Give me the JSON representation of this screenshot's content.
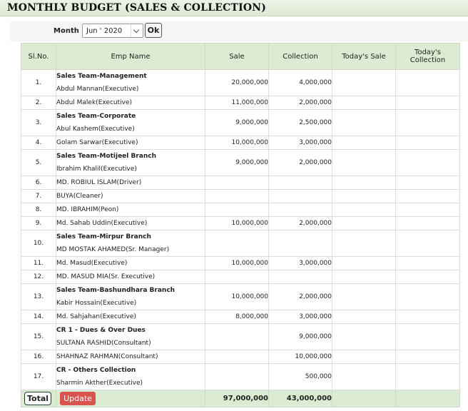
{
  "header": {
    "title": "MONTHLY BUDGET (SALES & COLLECTION)"
  },
  "filter": {
    "month_label": "Month",
    "month_value": "Jun ' 2020",
    "ok_label": "Ok"
  },
  "table": {
    "columns": [
      "Sl.No.",
      "Emp Name",
      "Sale",
      "Collection",
      "Today's Sale",
      "Today's Collection"
    ],
    "rows": [
      {
        "sl": "1.",
        "group": "Sales Team-Management",
        "name": "Abdul Mannan(Executive)",
        "sale": "20,000,000",
        "collection": "4,000,000"
      },
      {
        "sl": "2.",
        "group": "",
        "name": "Abdul Malek(Executive)",
        "sale": "11,000,000",
        "collection": "2,000,000"
      },
      {
        "sl": "3.",
        "group": "Sales Team-Corporate",
        "name": "Abul Kashem(Executive)",
        "sale": "9,000,000",
        "collection": "2,500,000"
      },
      {
        "sl": "4.",
        "group": "",
        "name": "Golam Sarwar(Executive)",
        "sale": "10,000,000",
        "collection": "3,000,000"
      },
      {
        "sl": "5.",
        "group": "Sales Team-Motijeel Branch",
        "name": "Ibrahim Khalil(Executive)",
        "sale": "9,000,000",
        "collection": "2,000,000"
      },
      {
        "sl": "6.",
        "group": "",
        "name": "MD. ROBIUL ISLAM(Driver)",
        "sale": "",
        "collection": ""
      },
      {
        "sl": "7.",
        "group": "",
        "name": "BUYA(Cleaner)",
        "sale": "",
        "collection": ""
      },
      {
        "sl": "8.",
        "group": "",
        "name": "MD. IBRAHIM(Peon)",
        "sale": "",
        "collection": ""
      },
      {
        "sl": "9.",
        "group": "",
        "name": "Md. Sahab Uddin(Executive)",
        "sale": "10,000,000",
        "collection": "2,000,000"
      },
      {
        "sl": "10.",
        "group": "Sales Team-Mirpur Branch",
        "name": "MD MOSTAK AHAMED(Sr. Manager)",
        "sale": "",
        "collection": ""
      },
      {
        "sl": "11.",
        "group": "",
        "name": "Md. Masud(Executive)",
        "sale": "10,000,000",
        "collection": "3,000,000"
      },
      {
        "sl": "12.",
        "group": "",
        "name": "MD. MASUD MIA(Sr. Executive)",
        "sale": "",
        "collection": ""
      },
      {
        "sl": "13.",
        "group": "Sales Team-Bashundhara Branch",
        "name": "Kabir Hossain(Executive)",
        "sale": "10,000,000",
        "collection": "2,000,000"
      },
      {
        "sl": "14.",
        "group": "",
        "name": "Md. Sahjahan(Executive)",
        "sale": "8,000,000",
        "collection": "3,000,000"
      },
      {
        "sl": "15.",
        "group": "CR 1 - Dues & Over Dues",
        "name": "SULTANA RASHID(Consultant)",
        "sale": "",
        "collection": "9,000,000"
      },
      {
        "sl": "16.",
        "group": "",
        "name": "SHAHNAZ RAHMAN(Consultant)",
        "sale": "",
        "collection": "10,000,000"
      },
      {
        "sl": "17.",
        "group": "CR - Others Collection",
        "name": "Sharmin Akther(Executive)",
        "sale": "",
        "collection": "500,000"
      }
    ],
    "total": {
      "label": "Total",
      "update_label": "Update",
      "sale": "97,000,000",
      "collection": "43,000,000"
    }
  },
  "colors": {
    "header_bg": "#dcecd2",
    "update_button": "#d9534f",
    "accent_dash": "#d9534f"
  }
}
